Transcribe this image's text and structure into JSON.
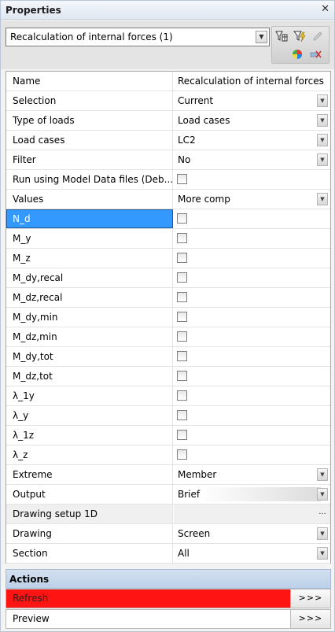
{
  "panel": {
    "title": "Properties",
    "close_symbol": "✕"
  },
  "selector": {
    "value": "Recalculation of internal forces (1)"
  },
  "toolbar": {
    "icons": [
      "filter-table-icon",
      "filter-lightning-icon",
      "pencil-icon",
      "pie-chart-icon",
      "clear-selection-icon"
    ]
  },
  "rows": [
    {
      "label": "Name",
      "value": "Recalculation of internal forces",
      "control": "text"
    },
    {
      "label": "Selection",
      "value": "Current",
      "control": "dropdown"
    },
    {
      "label": "Type of loads",
      "value": "Load cases",
      "control": "dropdown"
    },
    {
      "label": "Load cases",
      "value": "LC2",
      "control": "dropdown"
    },
    {
      "label": "Filter",
      "value": "No",
      "control": "dropdown"
    },
    {
      "label": "Run using Model Data files (Deb...",
      "value": "",
      "control": "checkbox",
      "checked": false
    },
    {
      "label": "Values",
      "value": "More comp",
      "control": "dropdown"
    },
    {
      "label": "N_d",
      "value": "",
      "control": "checkbox",
      "checked": false,
      "selected": true
    },
    {
      "label": "M_y",
      "value": "",
      "control": "checkbox",
      "checked": false
    },
    {
      "label": "M_z",
      "value": "",
      "control": "checkbox",
      "checked": false
    },
    {
      "label": "M_dy,recal",
      "value": "",
      "control": "checkbox",
      "checked": false
    },
    {
      "label": "M_dz,recal",
      "value": "",
      "control": "checkbox",
      "checked": false
    },
    {
      "label": "M_dy,min",
      "value": "",
      "control": "checkbox",
      "checked": false
    },
    {
      "label": "M_dz,min",
      "value": "",
      "control": "checkbox",
      "checked": false
    },
    {
      "label": "M_dy,tot",
      "value": "",
      "control": "checkbox",
      "checked": false
    },
    {
      "label": "M_dz,tot",
      "value": "",
      "control": "checkbox",
      "checked": false
    },
    {
      "label": "λ_1y",
      "value": "",
      "control": "checkbox",
      "checked": false
    },
    {
      "label": "λ_y",
      "value": "",
      "control": "checkbox",
      "checked": false
    },
    {
      "label": "λ_1z",
      "value": "",
      "control": "checkbox",
      "checked": false
    },
    {
      "label": "λ_z",
      "value": "",
      "control": "checkbox",
      "checked": false
    },
    {
      "label": "Extreme",
      "value": "Member",
      "control": "dropdown"
    },
    {
      "label": "Output",
      "value": "Brief",
      "control": "dropdown"
    },
    {
      "label": "Drawing setup 1D",
      "value": "",
      "control": "ellipsis",
      "grey": true
    },
    {
      "label": "Drawing",
      "value": "Screen",
      "control": "dropdown"
    },
    {
      "label": "Section",
      "value": "All",
      "control": "dropdown"
    }
  ],
  "actions": {
    "header": "Actions",
    "items": [
      {
        "label": "Refresh",
        "button": ">>>",
        "highlight": "#ff1414"
      },
      {
        "label": "Preview",
        "button": ">>>"
      }
    ]
  },
  "symbols": {
    "dropdown": "▼",
    "ellipsis": "..."
  }
}
